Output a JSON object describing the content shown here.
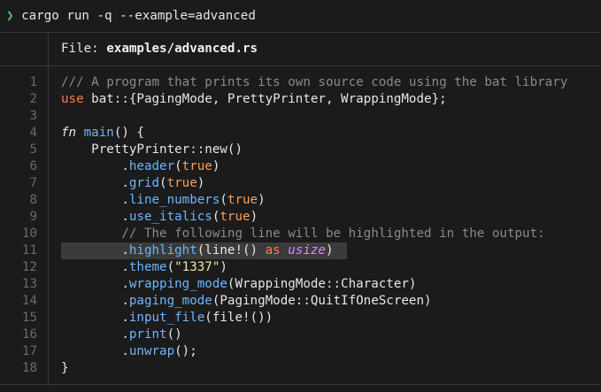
{
  "prompt": {
    "arrow": "❯",
    "command": " cargo run -q --example=advanced"
  },
  "file_header": {
    "label": "File: ",
    "filename": "examples/advanced.rs"
  },
  "colors": {
    "background": "#1b1b1b",
    "prompt_arrow": "#56c46b",
    "keyword": "#ff7b4a",
    "method": "#6cb6ff",
    "boolean": "#ff9d52",
    "string": "#f2e4a0",
    "comment": "#8a8a8a",
    "highlight_row": "#3b3b3b",
    "line_number": "#6a6a6a"
  },
  "highlighted_line": 11,
  "lines": [
    {
      "n": "1",
      "tokens": [
        {
          "t": "/// A program that prints its own source code using the bat library",
          "c": "t-comment"
        }
      ]
    },
    {
      "n": "2",
      "tokens": [
        {
          "t": "use",
          "c": "t-keyword"
        },
        {
          "t": " bat::{PagingMode, PrettyPrinter, WrappingMode};",
          "c": "t-plain"
        }
      ]
    },
    {
      "n": "3",
      "tokens": []
    },
    {
      "n": "4",
      "tokens": [
        {
          "t": "fn",
          "c": "t-fn-kw"
        },
        {
          "t": " ",
          "c": "t-plain"
        },
        {
          "t": "main",
          "c": "t-fn-name"
        },
        {
          "t": "() {",
          "c": "t-plain"
        }
      ]
    },
    {
      "n": "5",
      "tokens": [
        {
          "t": "    PrettyPrinter::new()",
          "c": "t-plain"
        }
      ]
    },
    {
      "n": "6",
      "tokens": [
        {
          "t": "        .",
          "c": "t-plain"
        },
        {
          "t": "header",
          "c": "t-method"
        },
        {
          "t": "(",
          "c": "t-plain"
        },
        {
          "t": "true",
          "c": "t-bool"
        },
        {
          "t": ")",
          "c": "t-plain"
        }
      ]
    },
    {
      "n": "7",
      "tokens": [
        {
          "t": "        .",
          "c": "t-plain"
        },
        {
          "t": "grid",
          "c": "t-method"
        },
        {
          "t": "(",
          "c": "t-plain"
        },
        {
          "t": "true",
          "c": "t-bool"
        },
        {
          "t": ")",
          "c": "t-plain"
        }
      ]
    },
    {
      "n": "8",
      "tokens": [
        {
          "t": "        .",
          "c": "t-plain"
        },
        {
          "t": "line_numbers",
          "c": "t-method"
        },
        {
          "t": "(",
          "c": "t-plain"
        },
        {
          "t": "true",
          "c": "t-bool"
        },
        {
          "t": ")",
          "c": "t-plain"
        }
      ]
    },
    {
      "n": "9",
      "tokens": [
        {
          "t": "        .",
          "c": "t-plain"
        },
        {
          "t": "use_italics",
          "c": "t-method"
        },
        {
          "t": "(",
          "c": "t-plain"
        },
        {
          "t": "true",
          "c": "t-bool"
        },
        {
          "t": ")",
          "c": "t-plain"
        }
      ]
    },
    {
      "n": "10",
      "tokens": [
        {
          "t": "        // The following line will be highlighted in the output:",
          "c": "t-comment"
        }
      ]
    },
    {
      "n": "11",
      "tokens": [
        {
          "t": "        .",
          "c": "t-plain"
        },
        {
          "t": "highlight",
          "c": "t-method"
        },
        {
          "t": "(line!() ",
          "c": "t-plain"
        },
        {
          "t": "as",
          "c": "t-keyword"
        },
        {
          "t": " ",
          "c": "t-plain"
        },
        {
          "t": "usize",
          "c": "t-type-italic"
        },
        {
          "t": ")",
          "c": "t-plain"
        }
      ]
    },
    {
      "n": "12",
      "tokens": [
        {
          "t": "        .",
          "c": "t-plain"
        },
        {
          "t": "theme",
          "c": "t-method"
        },
        {
          "t": "(",
          "c": "t-plain"
        },
        {
          "t": "\"1337\"",
          "c": "t-string"
        },
        {
          "t": ")",
          "c": "t-plain"
        }
      ]
    },
    {
      "n": "13",
      "tokens": [
        {
          "t": "        .",
          "c": "t-plain"
        },
        {
          "t": "wrapping_mode",
          "c": "t-method"
        },
        {
          "t": "(WrappingMode::Character)",
          "c": "t-plain"
        }
      ]
    },
    {
      "n": "14",
      "tokens": [
        {
          "t": "        .",
          "c": "t-plain"
        },
        {
          "t": "paging_mode",
          "c": "t-method"
        },
        {
          "t": "(PagingMode::QuitIfOneScreen)",
          "c": "t-plain"
        }
      ]
    },
    {
      "n": "15",
      "tokens": [
        {
          "t": "        .",
          "c": "t-plain"
        },
        {
          "t": "input_file",
          "c": "t-method"
        },
        {
          "t": "(file!())",
          "c": "t-plain"
        }
      ]
    },
    {
      "n": "16",
      "tokens": [
        {
          "t": "        .",
          "c": "t-plain"
        },
        {
          "t": "print",
          "c": "t-method"
        },
        {
          "t": "()",
          "c": "t-plain"
        }
      ]
    },
    {
      "n": "17",
      "tokens": [
        {
          "t": "        .",
          "c": "t-plain"
        },
        {
          "t": "unwrap",
          "c": "t-method"
        },
        {
          "t": "();",
          "c": "t-plain"
        }
      ]
    },
    {
      "n": "18",
      "tokens": [
        {
          "t": "}",
          "c": "t-plain"
        }
      ]
    }
  ]
}
